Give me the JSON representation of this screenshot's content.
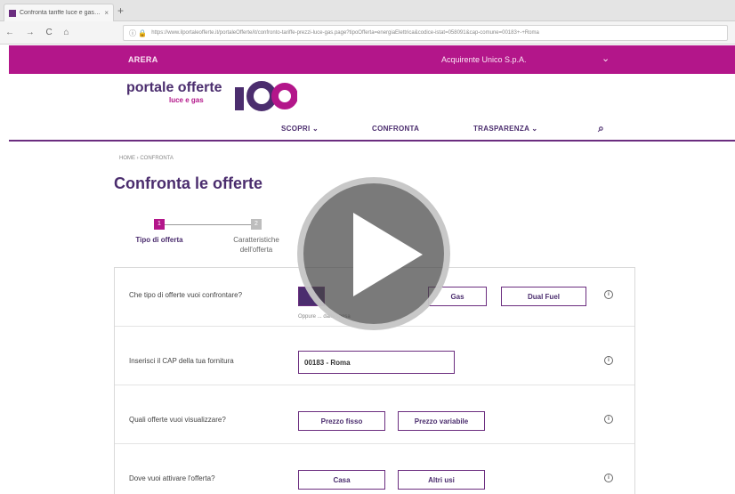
{
  "browser": {
    "tab_title": "Confronta tariffe luce e gas ...",
    "tab_close": "×",
    "new_tab": "+",
    "nav_buttons": "← → C ⌂",
    "address_icon": "ⓘ 🔒",
    "url": "https://www.ilportaleofferte.it/portaleOfferte/it/confronto-tariffe-prezzi-luce-gas.page?tipoOfferta=energiaElettrica&codice-istat=058091&cap-comune=00183+-+Roma"
  },
  "site": {
    "top_brand": "ARERA",
    "top_company": "Acquirente Unico S.p.A.",
    "top_chevron": "⌄",
    "logo_line1": "portale offerte",
    "logo_line2": "luce e gas",
    "logo_mark_color": "#4b2d6e",
    "accent_color": "#b3168a"
  },
  "nav": {
    "items": [
      {
        "label": "SCOPRI ⌄"
      },
      {
        "label": "CONFRONTA"
      },
      {
        "label": "TRASPARENZA ⌄"
      }
    ],
    "search_icon": "⌕"
  },
  "breadcrumb": "HOME › CONFRONTA",
  "page_title": "Confronta le offerte",
  "steps": [
    {
      "number": "1",
      "label": "Tipo di offerta"
    },
    {
      "number": "2",
      "label": "Caratteristiche dell'offerta"
    }
  ],
  "form": {
    "rows": [
      {
        "question": "Che tipo di offerte vuoi confrontare?",
        "options": [
          "Gas",
          "Dual Fuel"
        ],
        "hint": "Oppure ... dalla spesa"
      },
      {
        "question": "Inserisci il CAP della tua fornitura",
        "value": "00183 - Roma"
      },
      {
        "question": "Quali offerte vuoi visualizzare?",
        "options": [
          "Prezzo fisso",
          "Prezzo variabile"
        ]
      },
      {
        "question": "Dove vuoi attivare l'offerta?",
        "options": [
          "Casa",
          "Altri usi"
        ]
      }
    ],
    "info_icon": "i"
  },
  "video": {
    "play_icon": "play-icon"
  }
}
